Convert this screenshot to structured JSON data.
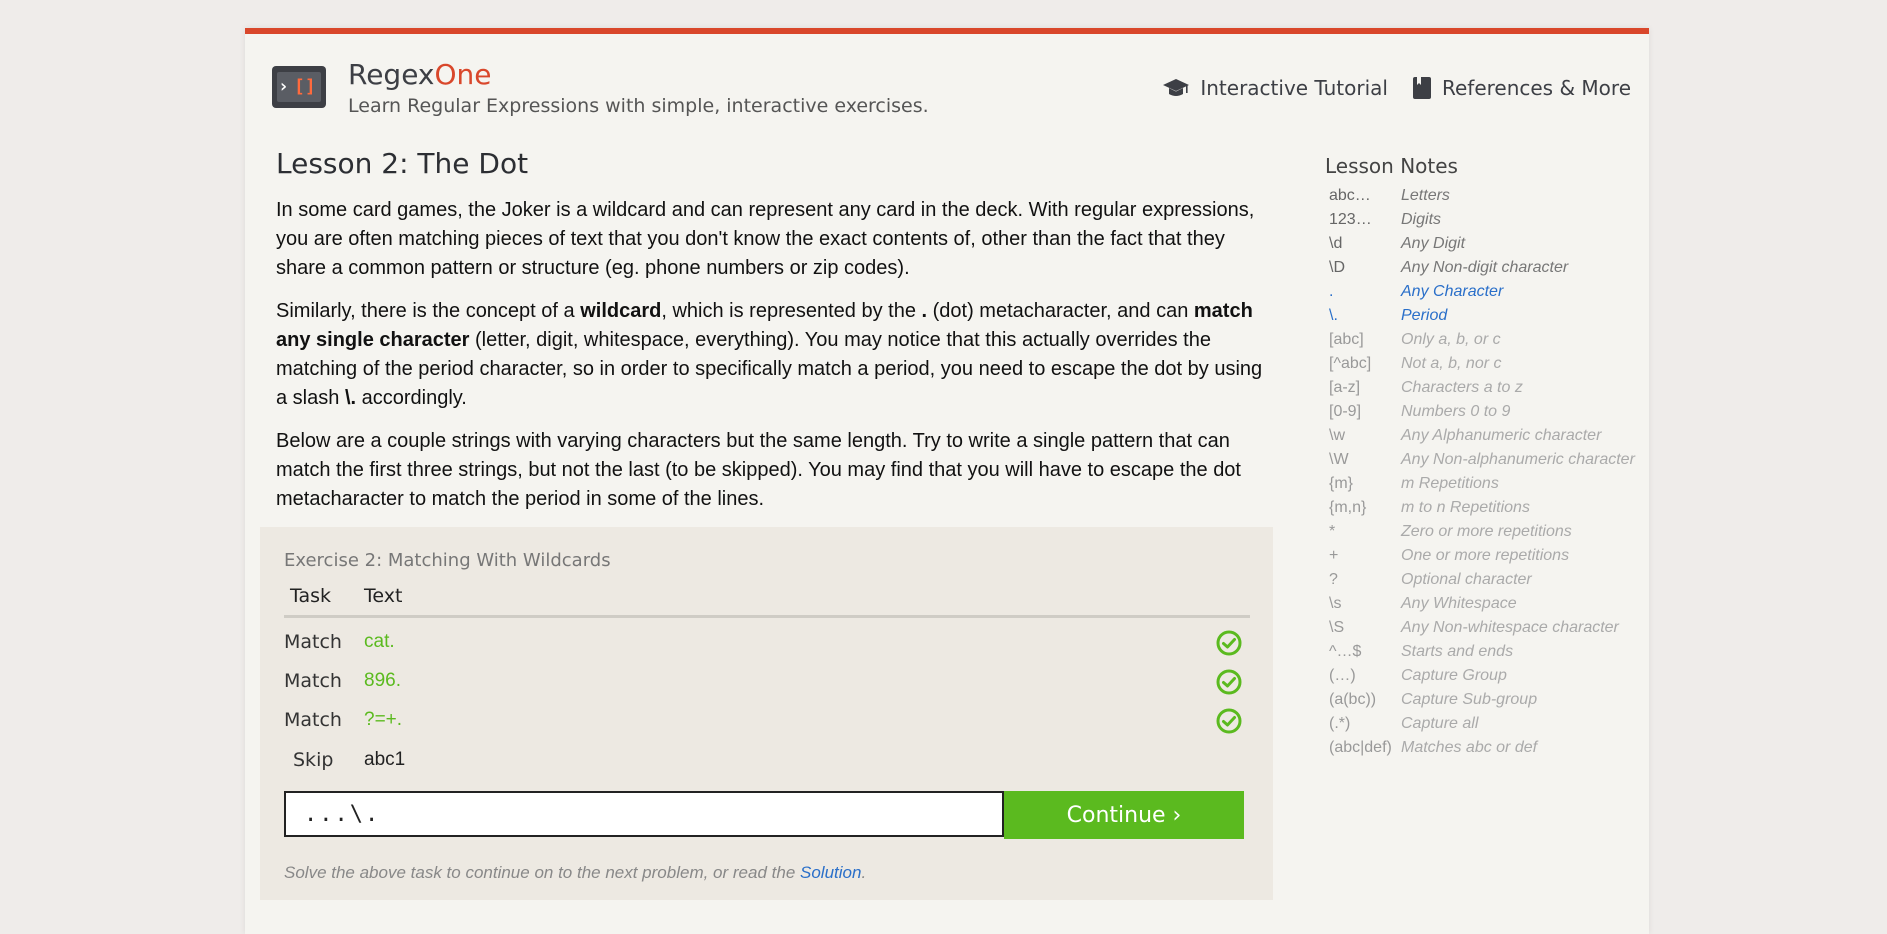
{
  "header": {
    "brand_main": "Regex",
    "brand_accent": "One",
    "tagline": "Learn Regular Expressions with simple, interactive exercises.",
    "nav": [
      {
        "label": "Interactive Tutorial",
        "icon": "graduation-cap-icon"
      },
      {
        "label": "References & More",
        "icon": "book-icon"
      }
    ]
  },
  "lesson": {
    "title": "Lesson 2: The Dot",
    "p1": "In some card games, the Joker is a wildcard and can represent any card in the deck. With regular expressions, you are often matching pieces of text that you don't know the exact contents of, other than the fact that they share a common pattern or structure (eg. phone numbers or zip codes).",
    "p2_a": "Similarly, there is the concept of a ",
    "p2_b": "wildcard",
    "p2_c": ", which is represented by the ",
    "p2_d": ".",
    "p2_e": " (dot) metacharacter, and can ",
    "p2_f": "match any single character",
    "p2_g": " (letter, digit, whitespace, everything). You may notice that this actually overrides the matching of the period character, so in order to specifically match a period, you need to escape the dot by using a slash ",
    "p2_h": "\\.",
    "p2_i": " accordingly.",
    "p3": "Below are a couple strings with varying characters but the same length. Try to write a single pattern that can match the first three strings, but not the last (to be skipped). You may find that you will have to escape the dot metacharacter to match the period in some of the lines."
  },
  "exercise": {
    "title": "Exercise 2: Matching With Wildcards",
    "col_task": "Task",
    "col_text": "Text",
    "rows": [
      {
        "task": "Match",
        "text": "cat.",
        "status": "ok"
      },
      {
        "task": "Match",
        "text": "896.",
        "status": "ok"
      },
      {
        "task": "Match",
        "text": "?=+.",
        "status": "ok"
      },
      {
        "task": "Skip",
        "text": "abc1",
        "status": "none"
      }
    ],
    "input_value": "...\\.",
    "continue_label": "Continue ›",
    "hint_prefix": "Solve the above task to continue on to the next problem, or read the ",
    "hint_link": "Solution",
    "hint_suffix": "."
  },
  "notes": {
    "title": "Lesson Notes",
    "items": [
      {
        "k": "abc…",
        "v": "Letters",
        "state": "seen"
      },
      {
        "k": "123…",
        "v": "Digits",
        "state": "seen"
      },
      {
        "k": "\\d",
        "v": "Any Digit",
        "state": "seen"
      },
      {
        "k": "\\D",
        "v": "Any Non-digit character",
        "state": "seen"
      },
      {
        "k": ".",
        "v": "Any Character",
        "state": "active"
      },
      {
        "k": "\\.",
        "v": "Period",
        "state": "active"
      },
      {
        "k": "[abc]",
        "v": "Only a, b, or c",
        "state": "future"
      },
      {
        "k": "[^abc]",
        "v": "Not a, b, nor c",
        "state": "future"
      },
      {
        "k": "[a-z]",
        "v": "Characters a to z",
        "state": "future"
      },
      {
        "k": "[0-9]",
        "v": "Numbers 0 to 9",
        "state": "future"
      },
      {
        "k": "\\w",
        "v": "Any Alphanumeric character",
        "state": "future"
      },
      {
        "k": "\\W",
        "v": "Any Non-alphanumeric character",
        "state": "future"
      },
      {
        "k": "{m}",
        "v": "m Repetitions",
        "state": "future"
      },
      {
        "k": "{m,n}",
        "v": "m to n Repetitions",
        "state": "future"
      },
      {
        "k": "*",
        "v": "Zero or more repetitions",
        "state": "future"
      },
      {
        "k": "+",
        "v": "One or more repetitions",
        "state": "future"
      },
      {
        "k": "?",
        "v": "Optional character",
        "state": "future"
      },
      {
        "k": "\\s",
        "v": "Any Whitespace",
        "state": "future"
      },
      {
        "k": "\\S",
        "v": "Any Non-whitespace character",
        "state": "future"
      },
      {
        "k": "^…$",
        "v": "Starts and ends",
        "state": "future"
      },
      {
        "k": "(…)",
        "v": "Capture Group",
        "state": "future"
      },
      {
        "k": "(a(bc))",
        "v": "Capture Sub-group",
        "state": "future"
      },
      {
        "k": "(.*)",
        "v": "Capture all",
        "state": "future"
      },
      {
        "k": "(abc|def)",
        "v": "Matches abc or def",
        "state": "future"
      }
    ]
  },
  "colors": {
    "accent": "#d9472b",
    "success": "#5bba1f",
    "link": "#2a6fc9"
  }
}
